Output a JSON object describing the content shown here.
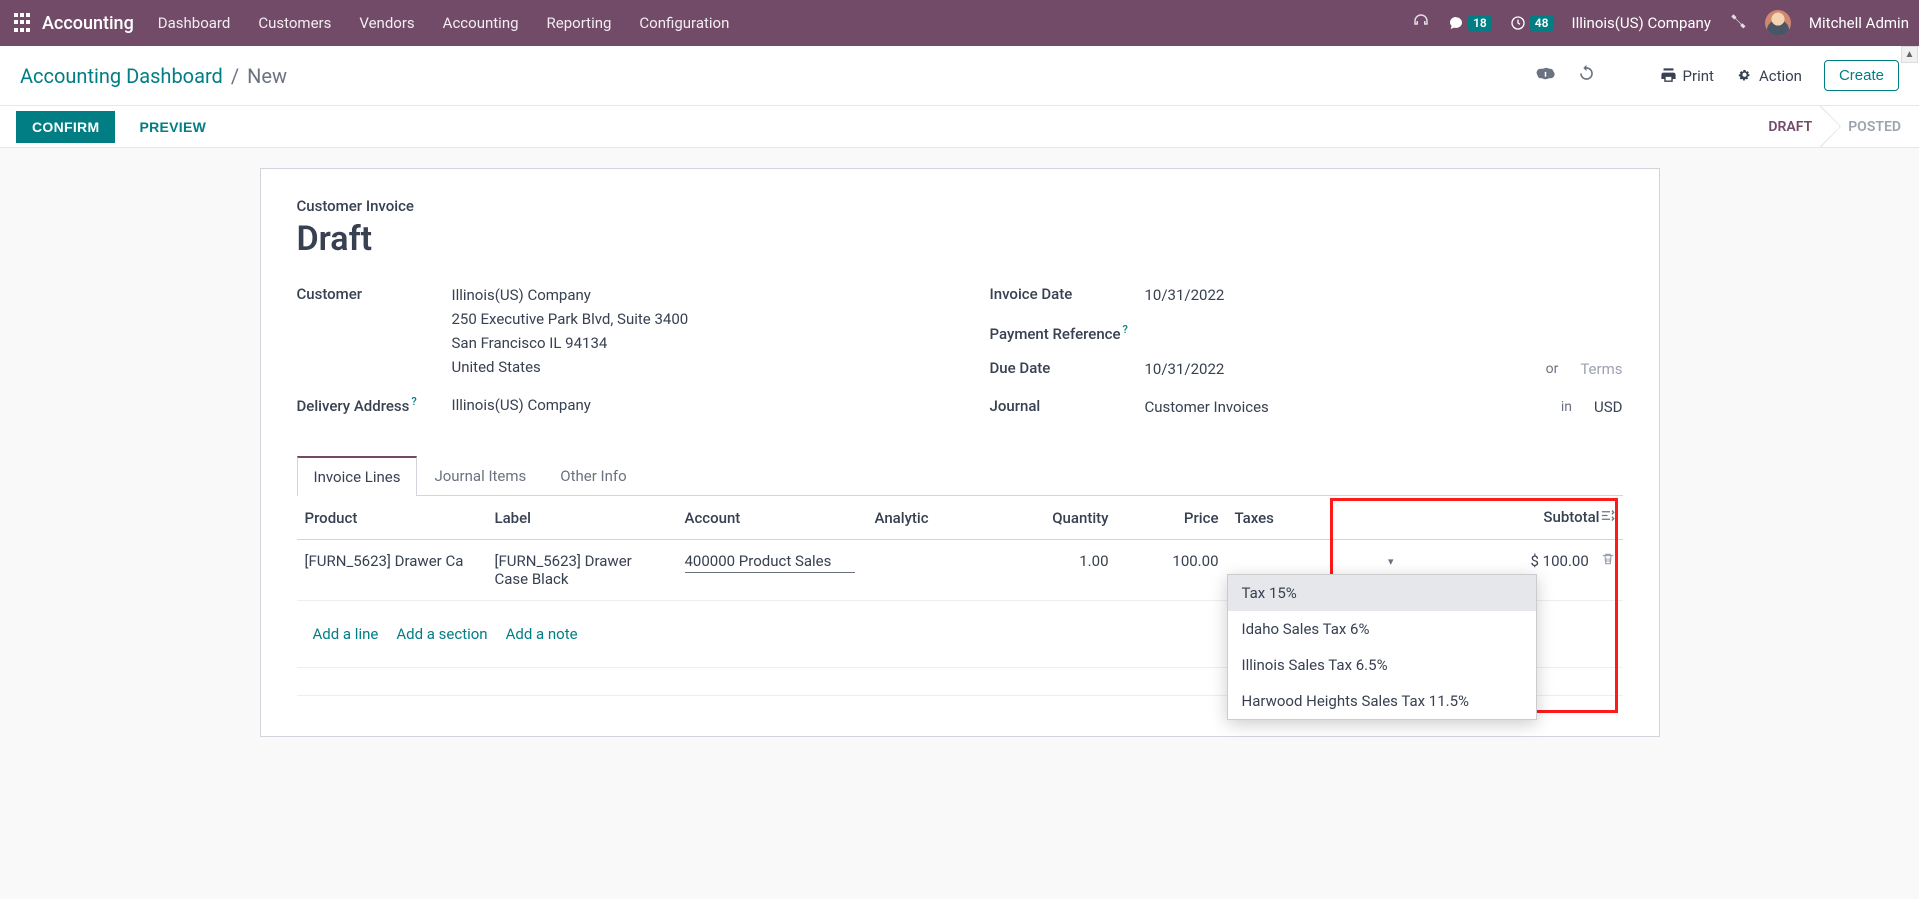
{
  "nav": {
    "brand": "Accounting",
    "links": [
      "Dashboard",
      "Customers",
      "Vendors",
      "Accounting",
      "Reporting",
      "Configuration"
    ],
    "messages_badge": "18",
    "activities_badge": "48",
    "company": "Illinois(US) Company",
    "user": "Mitchell Admin"
  },
  "controlbar": {
    "breadcrumb_root": "Accounting Dashboard",
    "breadcrumb_current": "New",
    "print": "Print",
    "action": "Action",
    "create": "Create"
  },
  "statusbar": {
    "confirm": "CONFIRM",
    "preview": "PREVIEW",
    "draft": "DRAFT",
    "posted": "POSTED"
  },
  "form": {
    "title_label": "Customer Invoice",
    "title": "Draft",
    "labels": {
      "customer": "Customer",
      "delivery_address": "Delivery Address",
      "invoice_date": "Invoice Date",
      "payment_reference": "Payment Reference",
      "due_date": "Due Date",
      "journal": "Journal"
    },
    "customer_name": "Illinois(US) Company",
    "customer_addr1": "250 Executive Park Blvd, Suite 3400",
    "customer_addr2": "San Francisco IL 94134",
    "customer_country": "United States",
    "delivery_address": "Illinois(US) Company",
    "invoice_date": "10/31/2022",
    "due_date": "10/31/2022",
    "due_or": "or",
    "terms_placeholder": "Terms",
    "journal": "Customer Invoices",
    "journal_in": "in",
    "currency": "USD"
  },
  "tabs": {
    "invoice_lines": "Invoice Lines",
    "journal_items": "Journal Items",
    "other_info": "Other Info"
  },
  "table": {
    "headers": {
      "product": "Product",
      "label": "Label",
      "account": "Account",
      "analytic": "Analytic",
      "quantity": "Quantity",
      "price": "Price",
      "taxes": "Taxes",
      "subtotal": "Subtotal"
    },
    "row": {
      "product": "[FURN_5623] Drawer Ca",
      "label": "[FURN_5623] Drawer Case Black",
      "account": "400000 Product Sales",
      "quantity": "1.00",
      "price": "100.00",
      "subtotal": "$ 100.00"
    },
    "add_line": "Add a line",
    "add_section": "Add a section",
    "add_note": "Add a note"
  },
  "tax_options": [
    "Tax 15%",
    "Idaho Sales Tax 6%",
    "Illinois Sales Tax 6.5%",
    "Harwood Heights Sales Tax 11.5%"
  ]
}
